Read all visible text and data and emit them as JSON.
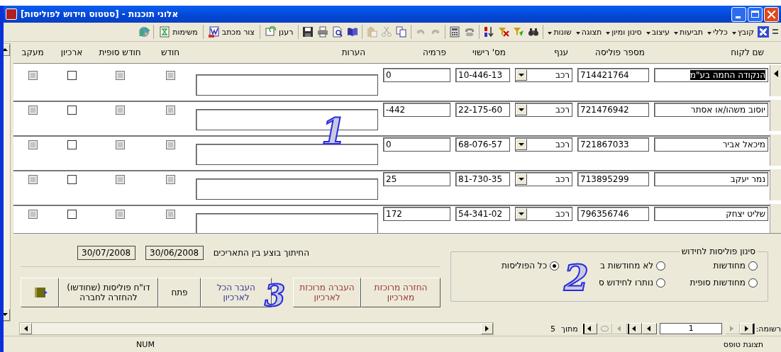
{
  "window": {
    "title": "אלוני תוכנות - [סטטוס חידוש לפוליסות]"
  },
  "toolbar": {
    "menus": [
      {
        "label": "קובץ"
      },
      {
        "label": "כללי"
      },
      {
        "label": "תביעות"
      },
      {
        "label": "עיצוב"
      },
      {
        "label": "סינון ומיון"
      },
      {
        "label": "תצוגה"
      },
      {
        "label": "שונות"
      }
    ],
    "tools": [
      {
        "kind": "binoculars",
        "disabled": false
      },
      {
        "kind": "funnel",
        "disabled": false
      },
      {
        "kind": "funnel-cross",
        "disabled": false
      },
      {
        "kind": "sort",
        "disabled": false
      },
      {
        "kind": "telephone",
        "disabled": false
      },
      {
        "kind": "calculator",
        "disabled": false
      },
      {
        "kind": "redo",
        "disabled": true
      },
      {
        "kind": "undo",
        "disabled": true
      },
      {
        "kind": "copy",
        "disabled": false
      },
      {
        "kind": "scissors",
        "disabled": true
      },
      {
        "kind": "clipboard",
        "disabled": true
      },
      {
        "kind": "book",
        "disabled": false
      },
      {
        "kind": "preview",
        "disabled": false
      },
      {
        "kind": "printer",
        "disabled": false
      },
      {
        "kind": "floppy-disk",
        "disabled": false
      }
    ],
    "buttons": [
      {
        "label": "רענן",
        "kind": "refresh"
      },
      {
        "label": "צור מכתב",
        "kind": "letter"
      },
      {
        "label": "משימות",
        "kind": "tasks"
      }
    ]
  },
  "columns": [
    "שם לקוח",
    "מספר פוליסה",
    "ענף",
    "מס' רישוי",
    "פרמיה",
    "הערות",
    "חודש",
    "חודש סופית",
    "ארכיון",
    "מעקב"
  ],
  "rows": [
    {
      "current": true,
      "text_selected": true,
      "customer": "הנקודה החמה בע\"מ",
      "policy": "714421764",
      "branch": "רכב",
      "license": "10-446-13",
      "premium": "0",
      "checks": [
        {
          "checked": false,
          "disabled": true
        },
        {
          "checked": false,
          "disabled": true
        },
        {
          "checked": false,
          "disabled": false
        },
        {
          "checked": false,
          "disabled": true
        }
      ]
    },
    {
      "current": false,
      "text_selected": false,
      "customer": "יוסוב משהו/או אסתר",
      "policy": "721476942",
      "branch": "רכב",
      "license": "22-175-60",
      "premium": "-442",
      "checks": [
        {
          "checked": false,
          "disabled": true
        },
        {
          "checked": false,
          "disabled": true
        },
        {
          "checked": false,
          "disabled": false
        },
        {
          "checked": false,
          "disabled": true
        }
      ]
    },
    {
      "current": false,
      "text_selected": false,
      "customer": "מיכאל אביר",
      "policy": "721867033",
      "branch": "רכב",
      "license": "68-076-57",
      "premium": "0",
      "checks": [
        {
          "checked": false,
          "disabled": true
        },
        {
          "checked": false,
          "disabled": true
        },
        {
          "checked": false,
          "disabled": false
        },
        {
          "checked": false,
          "disabled": true
        }
      ]
    },
    {
      "current": false,
      "text_selected": false,
      "customer": "נמר יעקב",
      "policy": "713895299",
      "branch": "רכב",
      "license": "81-730-35",
      "premium": "25",
      "checks": [
        {
          "checked": false,
          "disabled": true
        },
        {
          "checked": false,
          "disabled": true
        },
        {
          "checked": false,
          "disabled": false
        },
        {
          "checked": false,
          "disabled": true
        }
      ]
    },
    {
      "current": false,
      "text_selected": false,
      "customer": "שליט יצחק",
      "policy": "796356746",
      "branch": "רכב",
      "license": "54-341-02",
      "premium": "172",
      "checks": [
        {
          "checked": false,
          "disabled": true
        },
        {
          "checked": false,
          "disabled": true
        },
        {
          "checked": false,
          "disabled": false
        },
        {
          "checked": false,
          "disabled": true
        }
      ]
    }
  ],
  "cutoff": {
    "label": "החיתוך בוצע בין התאריכים",
    "from": "30/06/2008",
    "to": "30/07/2008"
  },
  "actions": [
    {
      "kind": "text",
      "label": "החזרה מרוכזת מארכיון",
      "color": "#993333"
    },
    {
      "kind": "text",
      "label": "העברה מרוכזת לארכיון",
      "color": "#993333"
    },
    {
      "kind": "text",
      "label": "העבר הכל לארכיון",
      "color": "#333399"
    },
    {
      "kind": "text",
      "label": "פתח",
      "color": "#000000"
    },
    {
      "kind": "text",
      "label": "דו\"ח פוליסות (שחודשו) להחזרה לחברה",
      "color": "#000000"
    },
    {
      "kind": "exit"
    }
  ],
  "filter": {
    "legend": "סינון פוליסות לחידוש",
    "options": [
      {
        "label": "מחודשות",
        "selected": false
      },
      {
        "label": "לא מחודשות ב",
        "selected": false
      },
      {
        "label": "כל הפוליסות",
        "selected": true
      },
      {
        "label": "מחודשות סופית",
        "selected": false
      },
      {
        "label": "נותרו לחידוש ס",
        "selected": false
      }
    ]
  },
  "callouts": [
    {
      "label": "1"
    },
    {
      "label": "2"
    },
    {
      "label": "3"
    }
  ],
  "navigation": {
    "label": "רשומה:",
    "current": "1",
    "of_label": "מתוך",
    "total": "5",
    "buttons": [
      {
        "kind": "first",
        "disabled": false
      },
      {
        "kind": "prev",
        "disabled": true
      },
      {
        "kind": "field"
      },
      {
        "kind": "next",
        "disabled": false
      },
      {
        "kind": "last",
        "disabled": false
      },
      {
        "kind": "new",
        "disabled": true
      },
      {
        "kind": "delete",
        "disabled": true
      },
      {
        "kind": "last",
        "disabled": false
      }
    ]
  },
  "status_bar": {
    "mode": "תצוגת טופס",
    "num": "NUM"
  }
}
